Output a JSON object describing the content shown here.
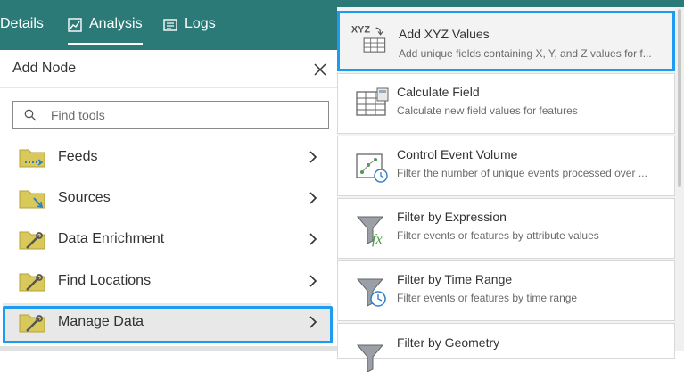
{
  "header": {
    "tabs": [
      {
        "label": "Details",
        "icon": "none"
      },
      {
        "label": "Analysis",
        "icon": "analysis-icon"
      },
      {
        "label": "Logs",
        "icon": "logs-icon"
      }
    ],
    "active_tab": "Analysis",
    "color": "#2b7a78"
  },
  "add_node": {
    "title": "Add Node",
    "search_placeholder": "Find tools",
    "categories": [
      {
        "label": "Feeds",
        "icon": "feeds-folder-icon"
      },
      {
        "label": "Sources",
        "icon": "sources-folder-icon"
      },
      {
        "label": "Data Enrichment",
        "icon": "data-enrichment-folder-icon"
      },
      {
        "label": "Find Locations",
        "icon": "find-locations-folder-icon"
      },
      {
        "label": "Manage Data",
        "icon": "manage-data-folder-icon",
        "selected": true
      }
    ]
  },
  "tools": [
    {
      "name": "Add XYZ Values",
      "description": "Add unique fields containing X, Y, and Z values for f...",
      "icon_text": "XYZ",
      "icon": "xyz-table-icon",
      "highlighted": true
    },
    {
      "name": "Calculate Field",
      "description": "Calculate new field values for features",
      "icon": "calculator-table-icon"
    },
    {
      "name": "Control Event Volume",
      "description": "Filter the number of unique events processed over ...",
      "icon": "event-volume-icon"
    },
    {
      "name": "Filter by Expression",
      "description": "Filter events or features by attribute values",
      "icon": "filter-expression-icon"
    },
    {
      "name": "Filter by Time Range",
      "description": "Filter events or features by time range",
      "icon": "filter-time-icon"
    },
    {
      "name": "Filter by Geometry",
      "description": "",
      "icon": "filter-geometry-icon"
    }
  ],
  "colors": {
    "highlight": "#1d9bf0",
    "folder": "#d9c85a"
  }
}
